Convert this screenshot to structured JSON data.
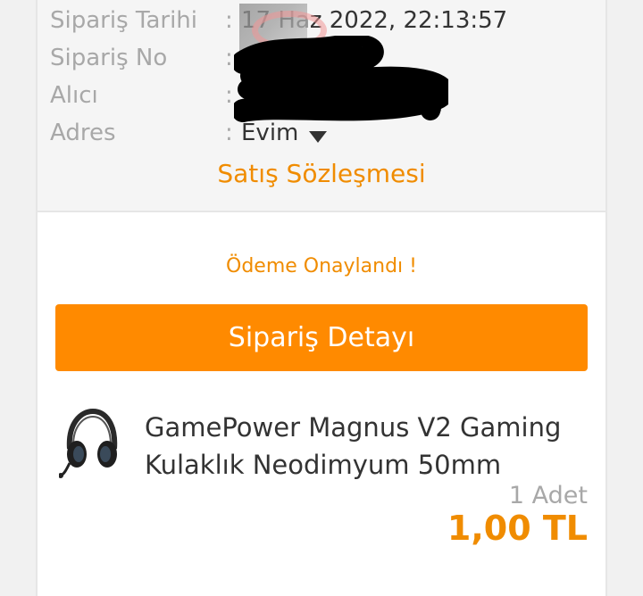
{
  "order_info": {
    "date_label": "Sipariş Tarihi",
    "date_value": "17 Haz 2022, 22:13:57",
    "number_label": "Sipariş No",
    "recipient_label": "Alıcı",
    "address_label": "Adres",
    "address_value": "Evim",
    "separator": ":"
  },
  "contract_link": "Satış Sözleşmesi",
  "payment_status": "Ödeme Onaylandı !",
  "detail_button": "Sipariş Detayı",
  "product": {
    "name": "GamePower Magnus V2 Gaming Kulaklık Neodimyum 50mm",
    "quantity": "1 Adet",
    "price": "1,00 TL",
    "image_icon": "headphones-icon"
  },
  "colors": {
    "accent": "#ff8a00",
    "accent_text": "#f08c00",
    "label": "#a8a8a8",
    "value": "#333333"
  }
}
